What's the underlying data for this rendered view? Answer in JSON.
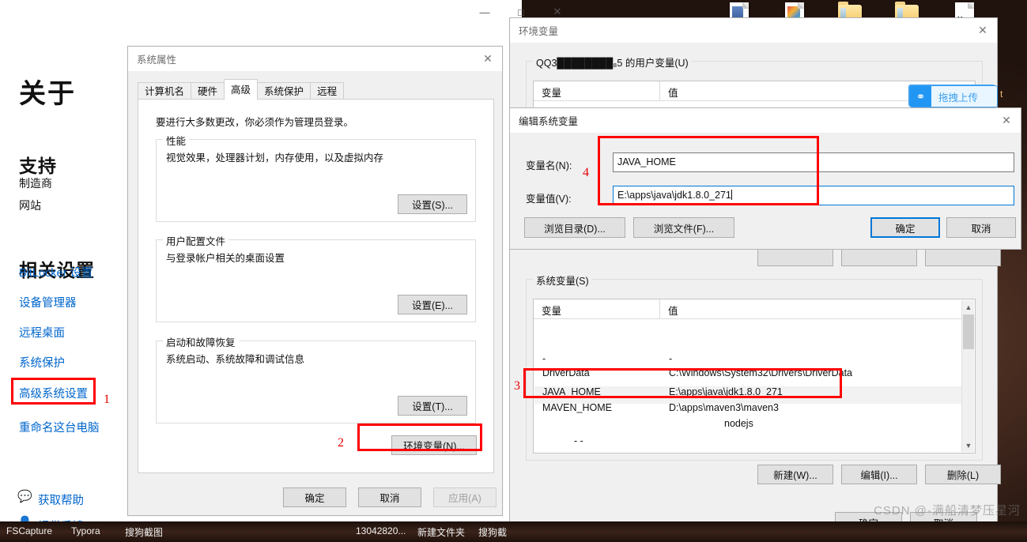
{
  "desktop": {
    "icons": [
      "document-icon",
      "image-doc-icon",
      "folder-icon",
      "folder-icon",
      "markdown-file-icon"
    ]
  },
  "settings_window": {
    "controls": {
      "minimize": "—",
      "maximize": "□",
      "close": "✕"
    },
    "page_title": "关于",
    "support_heading": "支持",
    "support_items": [
      "制造商",
      "网站"
    ],
    "related_heading": "相关设置",
    "related_links": [
      "BitLocker 设置",
      "设备管理器",
      "远程桌面",
      "系统保护",
      "高级系统设置",
      "重命名这台电脑"
    ],
    "footer_links": [
      {
        "icon": "help-bubble-icon",
        "label": "获取帮助"
      },
      {
        "icon": "feedback-person-icon",
        "label": "提供反馈"
      }
    ]
  },
  "system_properties": {
    "title": "系统属性",
    "close_glyph": "✕",
    "tabs": [
      {
        "label": "计算机名",
        "active": false
      },
      {
        "label": "硬件",
        "active": false
      },
      {
        "label": "高级",
        "active": true
      },
      {
        "label": "系统保护",
        "active": false
      },
      {
        "label": "远程",
        "active": false
      }
    ],
    "admin_note": "要进行大多数更改，你必须作为管理员登录。",
    "groups": [
      {
        "legend": "性能",
        "text": "视觉效果，处理器计划，内存使用，以及虚拟内存",
        "button": "设置(S)..."
      },
      {
        "legend": "用户配置文件",
        "text": "与登录帐户相关的桌面设置",
        "button": "设置(E)..."
      },
      {
        "legend": "启动和故障恢复",
        "text": "系统启动、系统故障和调试信息",
        "button": "设置(T)..."
      }
    ],
    "env_button": "环境变量(N)...",
    "footer_buttons": [
      {
        "label": "确定",
        "disabled": false
      },
      {
        "label": "取消",
        "disabled": false
      },
      {
        "label": "应用(A)",
        "disabled": true
      }
    ]
  },
  "environment_variables": {
    "title": "环境变量",
    "close_glyph": "✕",
    "user_group_legend": "QQ3████████₈5 的用户变量(U)",
    "columns": {
      "name": "变量",
      "value": "值"
    },
    "upload_widget": {
      "icon": "cloud-share-icon",
      "label": "拖拽上传"
    },
    "system_group_legend": "系统变量(S)",
    "system_rows": [
      {
        "name": "",
        "value": ""
      },
      {
        "name": "-",
        "value": "-"
      },
      {
        "name": "DriverData",
        "value": "C:\\Windows\\System32\\Drivers\\DriverData"
      },
      {
        "name": "JAVA_HOME",
        "value": "E:\\apps\\java\\jdk1.8.0_271",
        "selected": true
      },
      {
        "name": "MAVEN_HOME",
        "value": "D:\\apps\\maven3\\maven3"
      },
      {
        "name": "",
        "value": "nodejs"
      },
      {
        "name": "-  -",
        "value": ""
      }
    ],
    "row_buttons": [
      "新建(W)...",
      "编辑(I)...",
      "删除(L)"
    ],
    "footer_buttons": [
      "确定",
      "取消"
    ]
  },
  "edit_variable": {
    "title": "编辑系统变量",
    "close_glyph": "✕",
    "name_label": "变量名(N):",
    "name_value": "JAVA_HOME",
    "value_label": "变量值(V):",
    "value_value": "E:\\apps\\java\\jdk1.8.0_271",
    "browse_dir_button": "浏览目录(D)...",
    "browse_file_button": "浏览文件(F)...",
    "ok_button": "确定",
    "cancel_button": "取消"
  },
  "annotations": {
    "accent_color": "#ff0000",
    "numbers": [
      "1",
      "2",
      "3",
      "4"
    ]
  },
  "taskbar": {
    "items": [
      "FSCapture",
      "Typora",
      "搜狗截图",
      "13042820...",
      "新建文件夹",
      "搜狗截"
    ]
  },
  "watermark": "CSDN @-满船清梦压星河"
}
